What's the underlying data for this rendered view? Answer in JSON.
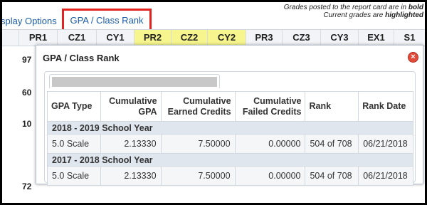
{
  "tabs": {
    "display_options": "splay Options",
    "gpa_class_rank": "GPA / Class Rank"
  },
  "notes": {
    "line1": "Grades posted to the report card are in bold",
    "line2": "Current grades are highlighted"
  },
  "grade_columns": [
    "PR1",
    "CZ1",
    "CY1",
    "PR2",
    "CZ2",
    "CY2",
    "PR3",
    "CZ3",
    "CY3",
    "EX1",
    "S1"
  ],
  "left_values": [
    "97",
    "60",
    "10",
    "72"
  ],
  "modal": {
    "title": "GPA / Class Rank",
    "close_label": "×",
    "table": {
      "headers": [
        "GPA Type",
        "Cumulative GPA",
        "Cumulative Earned Credits",
        "Cumulative Failed Credits",
        "Rank",
        "Rank Date"
      ],
      "sections": [
        {
          "label": "2018 - 2019 School Year",
          "row": [
            "5.0 Scale",
            "2.13330",
            "7.50000",
            "0.00000",
            "504 of 708",
            "06/21/2018"
          ]
        },
        {
          "label": "2017 - 2018 School Year",
          "row": [
            "5.0 Scale",
            "2.13330",
            "7.50000",
            "0.00000",
            "504 of 708",
            "06/21/2018"
          ]
        }
      ]
    }
  },
  "colors": {
    "highlight": "#f7f58e",
    "tab_border": "#e0241f",
    "link": "#1a5aa6",
    "section_bg": "#dfe6ee"
  }
}
